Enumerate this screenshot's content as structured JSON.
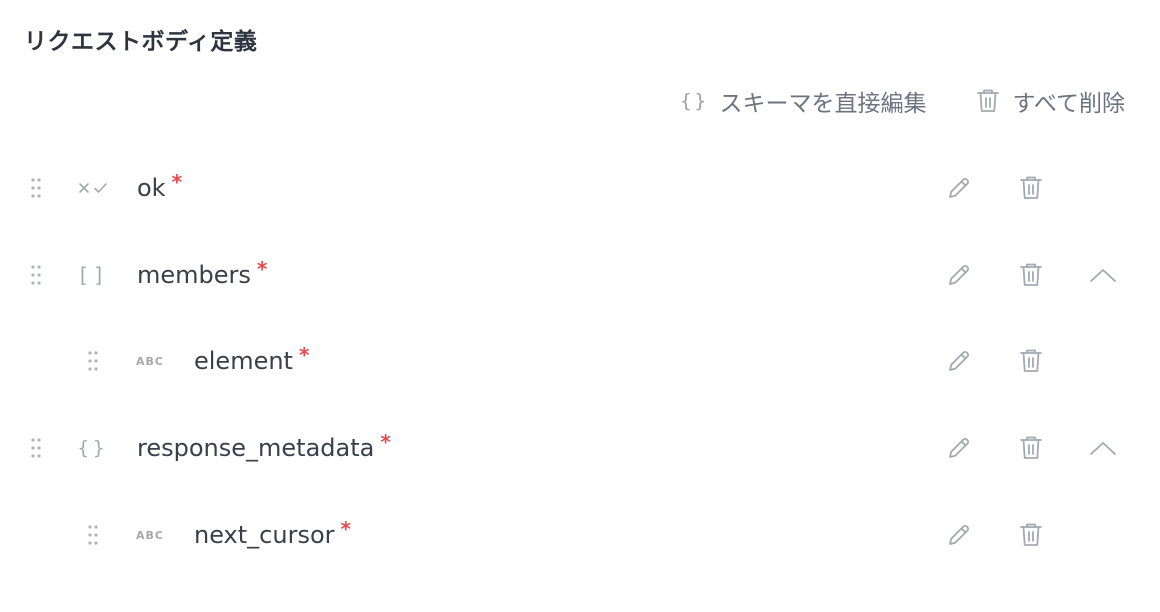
{
  "header": {
    "title": "リクエストボディ定義"
  },
  "toolbar": {
    "edit_schema_icon": "braces-icon",
    "edit_schema_label": "スキーマを直接編集",
    "delete_all_icon": "trash-icon",
    "delete_all_label": "すべて削除"
  },
  "fields": [
    {
      "name": "ok",
      "type": "boolean",
      "type_icon": "boolean-icon",
      "required_mark": "*",
      "depth": 0,
      "collapsible": false
    },
    {
      "name": "members",
      "type": "array",
      "type_icon": "array-icon",
      "required_mark": "*",
      "depth": 0,
      "collapsible": true
    },
    {
      "name": "element",
      "type": "string",
      "type_icon": "string-icon",
      "type_text": "ABC",
      "required_mark": "*",
      "depth": 1,
      "collapsible": false
    },
    {
      "name": "response_metadata",
      "type": "object",
      "type_icon": "object-icon",
      "required_mark": "*",
      "depth": 0,
      "collapsible": true
    },
    {
      "name": "next_cursor",
      "type": "string",
      "type_icon": "string-icon",
      "type_text": "ABC",
      "required_mark": "*",
      "depth": 1,
      "collapsible": false
    }
  ],
  "colors": {
    "required": "#e5484d",
    "icon": "#a3a9b0",
    "text": "#3a404b"
  }
}
